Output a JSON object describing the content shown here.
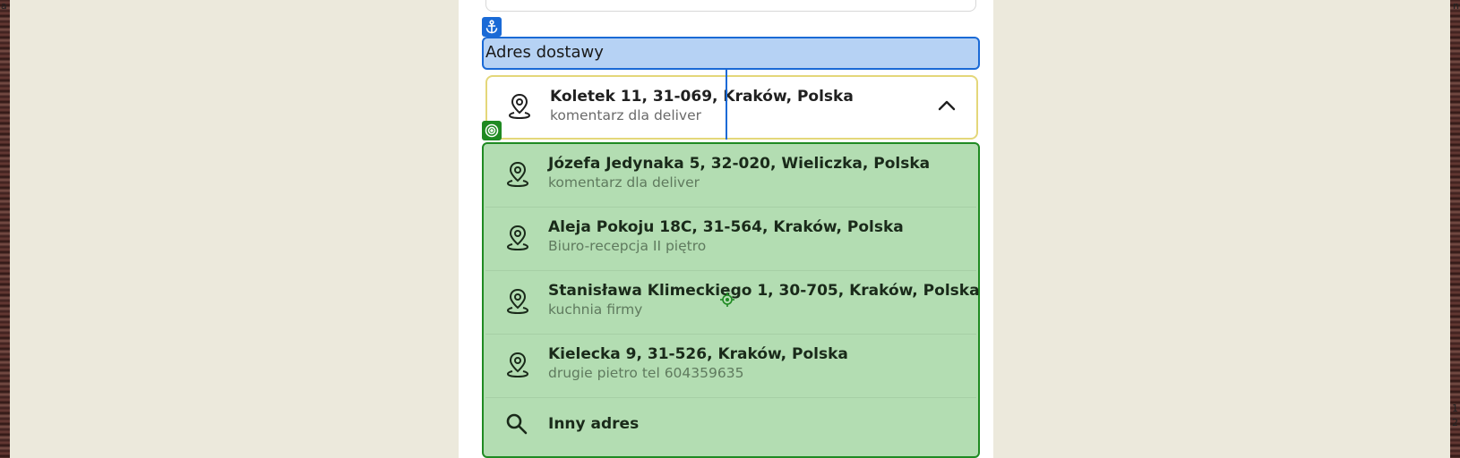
{
  "edge_left_text": "a",
  "edge_right_top": "n",
  "edge_right_bottom_1": "1",
  "edge_right_bottom_2": "2",
  "section_label": "Adres dostawy",
  "selected_address": {
    "line1": "Koletek 11, 31-069, Kraków, Polska",
    "line2": "komentarz dla deliver"
  },
  "options": [
    {
      "line1": "Józefa Jedynaka 5, 32-020, Wieliczka, Polska",
      "line2": "komentarz dla deliver"
    },
    {
      "line1": "Aleja Pokoju 18C, 31-564, Kraków, Polska",
      "line2": "Biuro-recepcja II piętro"
    },
    {
      "line1": "Stanisława Klimeckiego 1, 30-705, Kraków, Polska",
      "line2": "kuchnia firmy"
    },
    {
      "line1": "Kielecka 9, 31-526, Kraków, Polska",
      "line2": "drugie pietro tel 604359635"
    }
  ],
  "other_address_label": "Inny adres",
  "colors": {
    "background": "#ece9dc",
    "label_highlight": "#b6d2f4",
    "label_border": "#1a6ad6",
    "dropdown_highlight": "#b3ddb2",
    "dropdown_border": "#1f8a22",
    "selected_border": "#e4d77a"
  }
}
